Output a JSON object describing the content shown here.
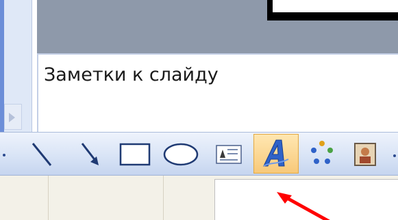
{
  "notes": {
    "text": "Заметки к слайду"
  },
  "drawing_toolbar": {
    "tools": [
      {
        "icon": "line-icon"
      },
      {
        "icon": "arrow-icon"
      },
      {
        "icon": "rectangle-icon"
      },
      {
        "icon": "oval-icon"
      },
      {
        "icon": "text-box-icon"
      },
      {
        "icon": "wordart-icon",
        "selected": true
      },
      {
        "icon": "diagram-icon"
      },
      {
        "icon": "clip-art-icon"
      }
    ]
  },
  "colors": {
    "toolbar_blue": "#d9e4f6",
    "selected_highlight": "#f8c979",
    "annotation_arrow": "#ff0000",
    "wordart_blue": "#2f62c8"
  }
}
